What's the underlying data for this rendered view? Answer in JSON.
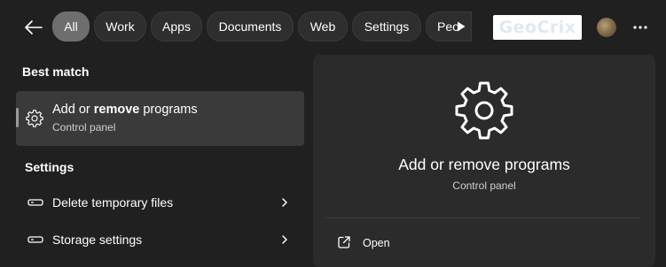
{
  "header": {
    "back_icon": "back-arrow-icon",
    "tabs": [
      {
        "label": "All",
        "active": true
      },
      {
        "label": "Work",
        "active": false
      },
      {
        "label": "Apps",
        "active": false
      },
      {
        "label": "Documents",
        "active": false
      },
      {
        "label": "Web",
        "active": false
      },
      {
        "label": "Settings",
        "active": false
      },
      {
        "label": "Peo",
        "active": false
      }
    ],
    "more_tabs_icon": "play-triangle-icon",
    "logo_text": "GeoCrix",
    "avatar": "user-avatar",
    "menu_icon": "more-dots-icon"
  },
  "results": {
    "best_match_heading": "Best match",
    "best_match": {
      "title_prefix": "Add or ",
      "title_bold": "remove",
      "title_suffix": " programs",
      "subtitle": "Control panel",
      "icon": "gear-icon"
    },
    "settings_heading": "Settings",
    "settings_items": [
      {
        "label": "Delete temporary files",
        "icon": "storage-drive-icon"
      },
      {
        "label": "Storage settings",
        "icon": "storage-drive-icon"
      }
    ]
  },
  "preview": {
    "icon": "gear-icon",
    "title": "Add or remove programs",
    "subtitle": "Control panel",
    "actions": [
      {
        "label": "Open",
        "icon": "open-external-icon"
      }
    ]
  },
  "colors": {
    "background": "#202020",
    "panel": "#2b2b2b",
    "selected_item": "#3a3a3a",
    "active_tab": "#6e6e6e"
  }
}
